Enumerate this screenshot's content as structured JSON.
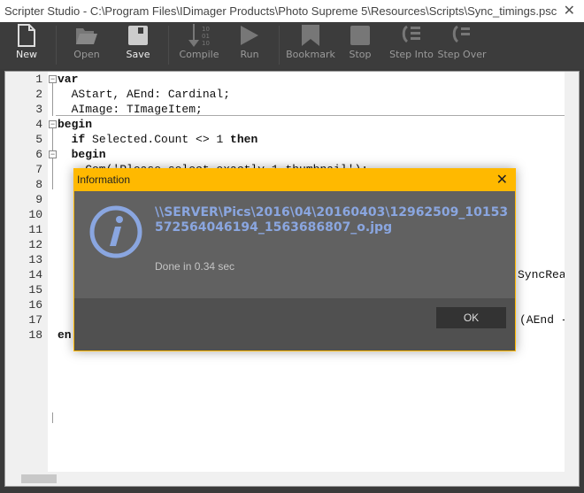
{
  "window": {
    "title": "Scripter Studio - C:\\Program Files\\IDimager Products\\Photo Supreme 5\\Resources\\Scripts\\Sync_timings.psc",
    "close": "✕"
  },
  "toolbar": [
    {
      "label": "New",
      "icon": "new-file-icon",
      "enabled": true
    },
    {
      "label": "Open",
      "icon": "folder-open-icon",
      "enabled": false
    },
    {
      "label": "Save",
      "icon": "save-icon",
      "enabled": true
    },
    {
      "label": "Compile",
      "icon": "compile-icon",
      "enabled": false
    },
    {
      "label": "Run",
      "icon": "play-icon",
      "enabled": false
    },
    {
      "label": "Bookmark",
      "icon": "bookmark-icon",
      "enabled": false
    },
    {
      "label": "Stop",
      "icon": "stop-icon",
      "enabled": false
    },
    {
      "label": "Step Into",
      "icon": "step-into-icon",
      "enabled": false
    },
    {
      "label": "Step Over",
      "icon": "step-over-icon",
      "enabled": false
    }
  ],
  "editor": {
    "line_numbers": [
      "1",
      "2",
      "3",
      "4",
      "5",
      "6",
      "7",
      "8",
      "9",
      "10",
      "11",
      "12",
      "13",
      "14",
      "15",
      "16",
      "17",
      "18"
    ],
    "lines": {
      "l1": "var",
      "l2": "  AStart, AEnd: Cardinal;",
      "l3": "  AImage: TImageItem;",
      "l4": "begin",
      "l5a": "  if",
      "l5b": " Selected.Count <> 1 ",
      "l5c": "then",
      "l6": "  begin",
      "l7": "    Com('Please select exactly 1 thumbnail');",
      "l14": "SyncRea",
      "l17": "(AEnd -",
      "l18": "en"
    }
  },
  "dialog": {
    "title": "Information",
    "close": "✕",
    "path": "\\\\SERVER\\Pics\\2016\\04\\20160403\\12962509_10153572564046194_1563686807_o.jpg",
    "message": "Done in 0.34 sec",
    "ok": "OK",
    "accent": "#FFB900",
    "icon": "info-icon"
  }
}
